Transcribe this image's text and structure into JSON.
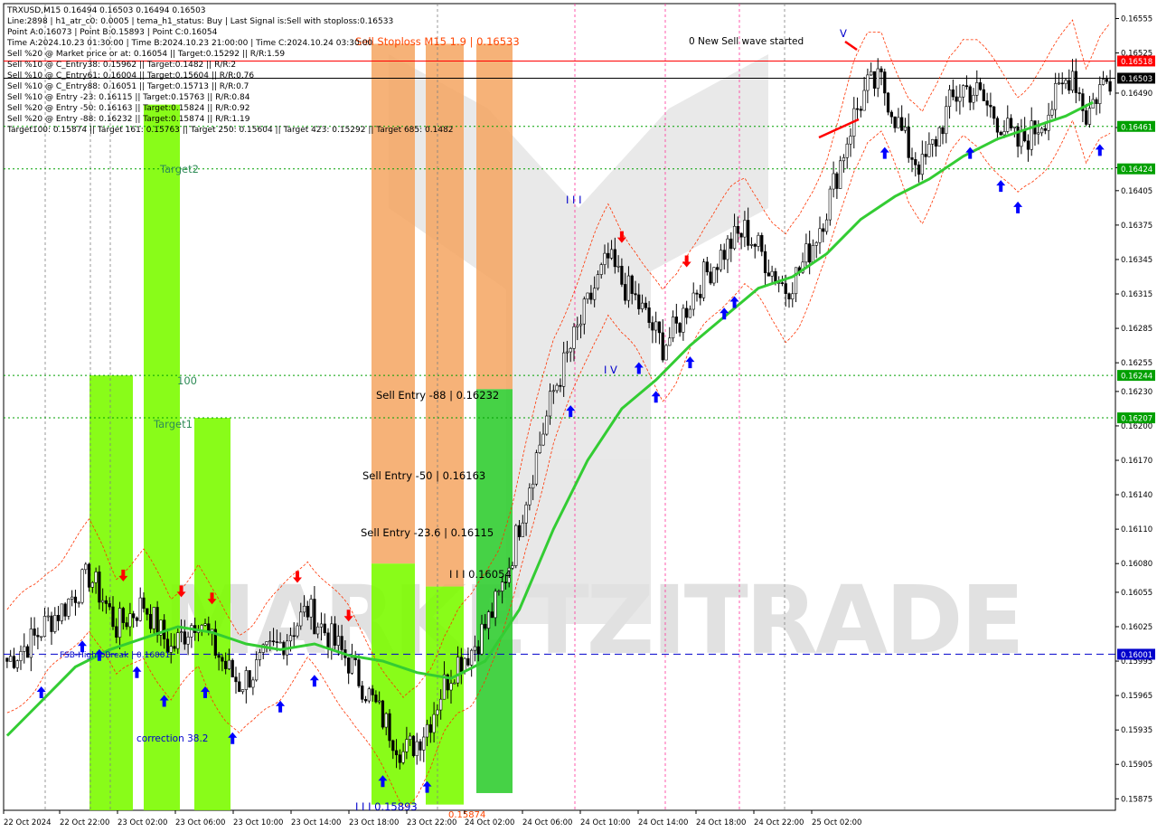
{
  "header": {
    "lines": [
      "TRXUSD,M15  0.16494 0.16503 0.16494 0.16503",
      "Line:2898  |  h1_atr_c0: 0.0005  |  tema_h1_status: Buy  |  Last Signal is:Sell with stoploss:0.16533",
      "Point A:0.16073  |  Point B:0.15893  |  Point C:0.16054",
      "Time A:2024.10.23 01:30:00  |  Time B:2024.10.23 21:00:00  |  Time C:2024.10.24 03:30:00",
      "Sell %20 @ Market price or at: 0.16054  ||  Target:0.15292  ||  R/R:1.59",
      "Sell %10 @ C_Entry38: 0.15962  ||  Target:0.1482  ||  R/R:2",
      "Sell %10 @ C_Entry61: 0.16004  ||  Target:0.15604  ||  R/R:0.76",
      "Sell %10 @ C_Entry88: 0.16051  ||  Target:0.15713  ||  R/R:0.7",
      "Sell %10 @ Entry -23: 0.16115  ||  Target:0.15763  ||  R/R:0.84",
      "Sell %20 @ Entry -50: 0.16163  ||  Target:0.15824  ||  R/R:0.92",
      "Sell %20 @ Entry -88: 0.16232  ||  Target:0.15874  ||  R/R:1.19",
      "Target100: 0.15874  ||  Target 161: 0.15763  ||  Target 250: 0.15604  ||  Target 423: 0.15292  ||  Target 685: 0.1482"
    ]
  },
  "watermark": "MARKETZITRADE",
  "chart_data": {
    "type": "candlestick",
    "symbol": "TRXUSD",
    "timeframe": "M15",
    "ylim": [
      0.15865,
      0.16568
    ],
    "y_ticks": [
      "0.16555",
      "0.16525",
      "0.16490",
      "0.16460",
      "0.16425",
      "0.16405",
      "0.16375",
      "0.16345",
      "0.16315",
      "0.16285",
      "0.16255",
      "0.16230",
      "0.16200",
      "0.16170",
      "0.16140",
      "0.16110",
      "0.16080",
      "0.16055",
      "0.16025",
      "0.15995",
      "0.15965",
      "0.15935",
      "0.15905",
      "0.15875"
    ],
    "x_ticks": [
      "22 Oct 2024",
      "22 Oct 22:00",
      "23 Oct 02:00",
      "23 Oct 06:00",
      "23 Oct 10:00",
      "23 Oct 14:00",
      "23 Oct 18:00",
      "23 Oct 22:00",
      "24 Oct 02:00",
      "24 Oct 06:00",
      "24 Oct 10:00",
      "24 Oct 14:00",
      "24 Oct 18:00",
      "24 Oct 22:00",
      "25 Oct 02:00"
    ],
    "price_levels": [
      {
        "value": 0.16518,
        "label": "0.16518",
        "color": "#ff0000",
        "style": "solid"
      },
      {
        "value": 0.16503,
        "label": "0.16503",
        "color": "#000000",
        "style": "solid"
      },
      {
        "value": 0.16461,
        "label": "0.16461",
        "color": "#00a000",
        "style": "dotted"
      },
      {
        "value": 0.16424,
        "label": "0.16424",
        "color": "#00a000",
        "style": "dotted"
      },
      {
        "value": 0.16244,
        "label": "0.16244",
        "color": "#00a000",
        "style": "dotted"
      },
      {
        "value": 0.16207,
        "label": "0.16207",
        "color": "#00a000",
        "style": "dotted"
      },
      {
        "value": 0.16001,
        "label": "0.16001",
        "color": "#0000cc",
        "style": "dashed"
      }
    ],
    "zone_labels": [
      {
        "text": "Sell Stoploss M15 1.9 | 0.16533",
        "color": "#ff4500"
      },
      {
        "text": "0 New Sell wave started",
        "color": "#000000"
      },
      {
        "text": "Target2",
        "color": "#2e8b57"
      },
      {
        "text": "100",
        "color": "#2e8b57"
      },
      {
        "text": "Target1",
        "color": "#2e8b57"
      },
      {
        "text": "Sell Entry -88 | 0.16232",
        "color": "#000000"
      },
      {
        "text": "Sell Entry -50 | 0.16163",
        "color": "#000000"
      },
      {
        "text": "Sell Entry -23.6 | 0.16115",
        "color": "#000000"
      },
      {
        "text": "I I I 0.16054",
        "color": "#000000"
      },
      {
        "text": "FSB-HighToBreak | 0.16001",
        "color": "#0000cc"
      },
      {
        "text": "correction 38.2",
        "color": "#0000cc"
      },
      {
        "text": "I I I 0.15893",
        "color": "#0000cc"
      },
      {
        "text": "0.15874",
        "color": "#ff4500"
      },
      {
        "text": "I I I",
        "color": "#0000cc"
      },
      {
        "text": "I V",
        "color": "#0000cc"
      },
      {
        "text": "V",
        "color": "#0000cc"
      }
    ],
    "colors": {
      "stoploss_zone": "#f4a460",
      "entry_zone": "#32cd32",
      "target_zone": "#7cfc00",
      "ma_line": "#33cc33",
      "band_line": "#ff3300"
    },
    "close_path": [
      [
        0,
        0.15995
      ],
      [
        4,
        0.16005
      ],
      [
        8,
        0.16015
      ],
      [
        12,
        0.1603
      ],
      [
        16,
        0.1604
      ],
      [
        20,
        0.16055
      ],
      [
        24,
        0.1607
      ],
      [
        28,
        0.1605
      ],
      [
        32,
        0.16025
      ],
      [
        36,
        0.16035
      ],
      [
        40,
        0.16045
      ],
      [
        44,
        0.16025
      ],
      [
        48,
        0.16005
      ],
      [
        52,
        0.1602
      ],
      [
        56,
        0.16035
      ],
      [
        60,
        0.1601
      ],
      [
        64,
        0.1599
      ],
      [
        68,
        0.15975
      ],
      [
        72,
        0.15985
      ],
      [
        76,
        0.16
      ],
      [
        80,
        0.1601
      ],
      [
        84,
        0.16025
      ],
      [
        88,
        0.1604
      ],
      [
        92,
        0.16025
      ],
      [
        96,
        0.1601
      ],
      [
        100,
        0.15995
      ],
      [
        104,
        0.15975
      ],
      [
        108,
        0.15955
      ],
      [
        112,
        0.15935
      ],
      [
        116,
        0.15915
      ],
      [
        120,
        0.15925
      ],
      [
        124,
        0.15945
      ],
      [
        128,
        0.15975
      ],
      [
        132,
        0.15995
      ],
      [
        136,
        0.16005
      ],
      [
        140,
        0.16025
      ],
      [
        144,
        0.1605
      ],
      [
        148,
        0.1609
      ],
      [
        152,
        0.1614
      ],
      [
        156,
        0.16185
      ],
      [
        160,
        0.1623
      ],
      [
        164,
        0.1626
      ],
      [
        168,
        0.1629
      ],
      [
        172,
        0.1632
      ],
      [
        176,
        0.16345
      ],
      [
        180,
        0.16325
      ],
      [
        184,
        0.1631
      ],
      [
        188,
        0.1629
      ],
      [
        192,
        0.1627
      ],
      [
        196,
        0.16285
      ],
      [
        200,
        0.1631
      ],
      [
        204,
        0.1633
      ],
      [
        208,
        0.16345
      ],
      [
        212,
        0.1636
      ],
      [
        216,
        0.1637
      ],
      [
        220,
        0.16355
      ],
      [
        224,
        0.16335
      ],
      [
        228,
        0.1632
      ],
      [
        232,
        0.16335
      ],
      [
        236,
        0.1636
      ],
      [
        240,
        0.1639
      ],
      [
        244,
        0.1643
      ],
      [
        248,
        0.1647
      ],
      [
        252,
        0.16495
      ],
      [
        256,
        0.165
      ],
      [
        260,
        0.1647
      ],
      [
        264,
        0.1644
      ],
      [
        268,
        0.16425
      ],
      [
        272,
        0.1645
      ],
      [
        276,
        0.1648
      ],
      [
        280,
        0.16495
      ],
      [
        284,
        0.1649
      ],
      [
        288,
        0.16475
      ],
      [
        292,
        0.1646
      ],
      [
        296,
        0.16445
      ],
      [
        300,
        0.16455
      ],
      [
        304,
        0.1647
      ],
      [
        308,
        0.1649
      ],
      [
        312,
        0.1651
      ],
      [
        316,
        0.1647
      ],
      [
        320,
        0.16495
      ],
      [
        323,
        0.16503
      ]
    ],
    "ma_path": [
      [
        0,
        0.1593
      ],
      [
        10,
        0.1596
      ],
      [
        20,
        0.1599
      ],
      [
        30,
        0.16005
      ],
      [
        40,
        0.16015
      ],
      [
        50,
        0.16025
      ],
      [
        60,
        0.1602
      ],
      [
        70,
        0.1601
      ],
      [
        80,
        0.16005
      ],
      [
        90,
        0.1601
      ],
      [
        100,
        0.16
      ],
      [
        110,
        0.15995
      ],
      [
        120,
        0.15985
      ],
      [
        130,
        0.1598
      ],
      [
        140,
        0.15995
      ],
      [
        150,
        0.1604
      ],
      [
        160,
        0.1611
      ],
      [
        170,
        0.1617
      ],
      [
        180,
        0.16215
      ],
      [
        190,
        0.1624
      ],
      [
        200,
        0.1627
      ],
      [
        210,
        0.16295
      ],
      [
        220,
        0.1632
      ],
      [
        230,
        0.1633
      ],
      [
        240,
        0.1635
      ],
      [
        250,
        0.1638
      ],
      [
        260,
        0.164
      ],
      [
        270,
        0.16415
      ],
      [
        280,
        0.16435
      ],
      [
        290,
        0.1645
      ],
      [
        300,
        0.1646
      ],
      [
        310,
        0.1647
      ],
      [
        318,
        0.16482
      ]
    ]
  }
}
